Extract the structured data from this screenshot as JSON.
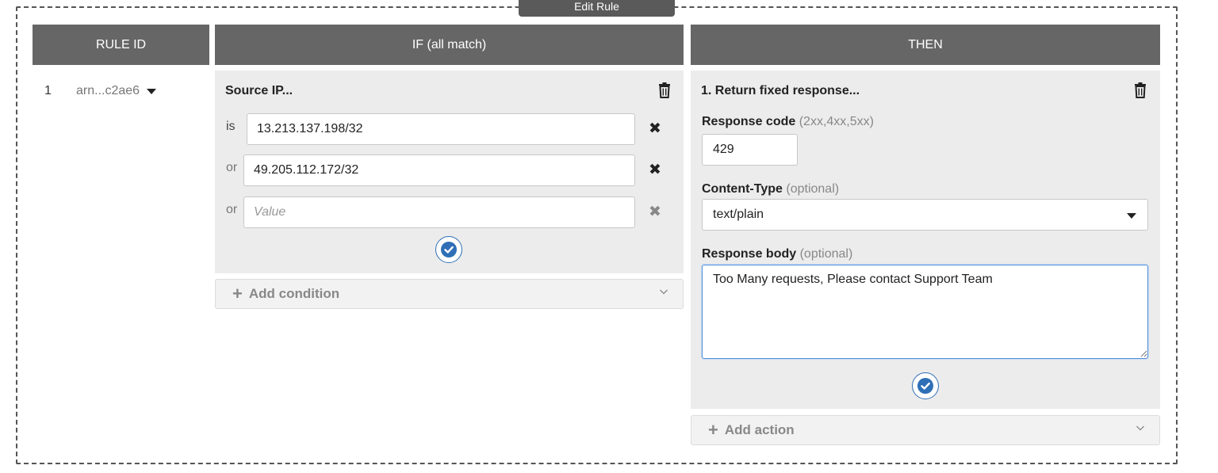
{
  "edit_tag": "Edit Rule",
  "headers": {
    "rule_id": "RULE ID",
    "if": "IF (all match)",
    "then": "THEN"
  },
  "rule": {
    "number": "1",
    "arn": "arn...c2ae6"
  },
  "if_panel": {
    "title": "Source IP...",
    "conditions": [
      {
        "operator": "is",
        "value": "13.213.137.198/32"
      },
      {
        "operator": "or",
        "value": "49.205.112.172/32"
      },
      {
        "operator": "or",
        "value": "",
        "placeholder": "Value"
      }
    ],
    "add_label": "Add condition"
  },
  "then_panel": {
    "title": "1. Return fixed response...",
    "response_code": {
      "label": "Response code",
      "hint": "(2xx,4xx,5xx)",
      "value": "429"
    },
    "content_type": {
      "label": "Content-Type",
      "hint": "(optional)",
      "value": "text/plain"
    },
    "response_body": {
      "label": "Response body",
      "hint": "(optional)",
      "value": "Too Many requests, Please contact Support Team"
    },
    "add_label": "Add action"
  },
  "colors": {
    "header": "#666666",
    "panel": "#ececec",
    "accent": "#2f6fb6",
    "focus": "#4d8fe0"
  },
  "icons": {
    "delete": "trash-icon",
    "remove": "close-icon",
    "confirm": "checkmark-icon",
    "add": "plus-icon",
    "expand": "chevron-down-icon",
    "dropdown": "caret-down-icon"
  }
}
